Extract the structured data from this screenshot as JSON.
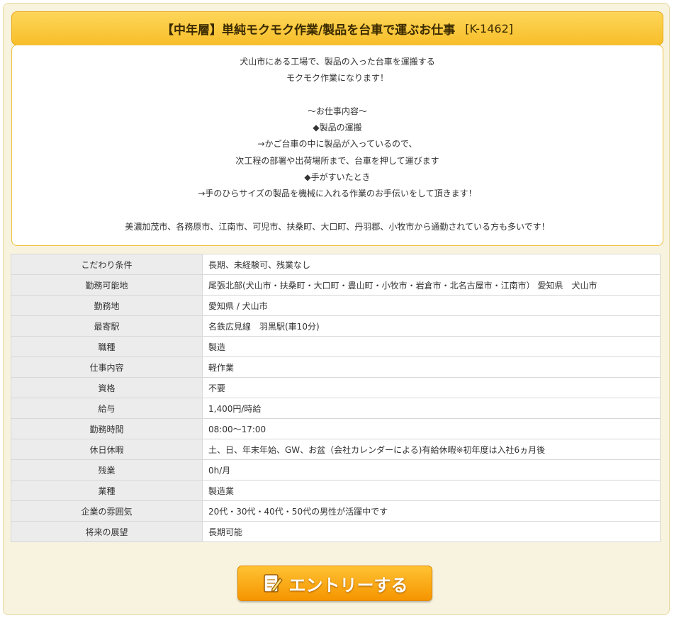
{
  "header": {
    "title": "【中年層】単純モクモク作業/製品を台車で運ぶお仕事",
    "code": "[K-1462]"
  },
  "description": {
    "lines": [
      "犬山市にある工場で、製品の入った台車を運搬する",
      "モクモク作業になります！",
      "",
      "～お仕事内容～",
      "◆製品の運搬",
      "→かご台車の中に製品が入っているので、",
      "次工程の部署や出荷場所まで、台車を押して運びます",
      "◆手がすいたとき",
      "→手のひらサイズの製品を機械に入れる作業のお手伝いをして頂きます！",
      "",
      "美濃加茂市、各務原市、江南市、可児市、扶桑町、大口町、丹羽郡、小牧市から通勤されている方も多いです！"
    ]
  },
  "details": [
    {
      "label": "こだわり条件",
      "value": "長期、未経験可、残業なし"
    },
    {
      "label": "勤務可能地",
      "value": "尾張北部(犬山市・扶桑町・大口町・豊山町・小牧市・岩倉市・北名古屋市・江南市） 愛知県　犬山市"
    },
    {
      "label": "勤務地",
      "value": "愛知県 / 犬山市"
    },
    {
      "label": "最寄駅",
      "value": "名鉄広見線　羽黒駅(車10分)"
    },
    {
      "label": "職種",
      "value": "製造"
    },
    {
      "label": "仕事内容",
      "value": "軽作業"
    },
    {
      "label": "資格",
      "value": "不要"
    },
    {
      "label": "給与",
      "value": "1,400円/時給"
    },
    {
      "label": "勤務時間",
      "value": "08:00～17:00"
    },
    {
      "label": "休日休暇",
      "value": "土、日、年末年始、GW、お盆（会社カレンダーによる)有給休暇※初年度は入社6ヵ月後"
    },
    {
      "label": "残業",
      "value": "0h/月"
    },
    {
      "label": "業種",
      "value": "製造業"
    },
    {
      "label": "企業の雰囲気",
      "value": "20代・30代・40代・50代の男性が活躍中です"
    },
    {
      "label": "将来の展望",
      "value": "長期可能"
    }
  ],
  "entry_button": {
    "label": "エントリーする",
    "icon": "note-pencil-icon"
  },
  "colors": {
    "accent": "#f7be29",
    "button": "#f59500",
    "panel_bg": "#f8f3de"
  }
}
